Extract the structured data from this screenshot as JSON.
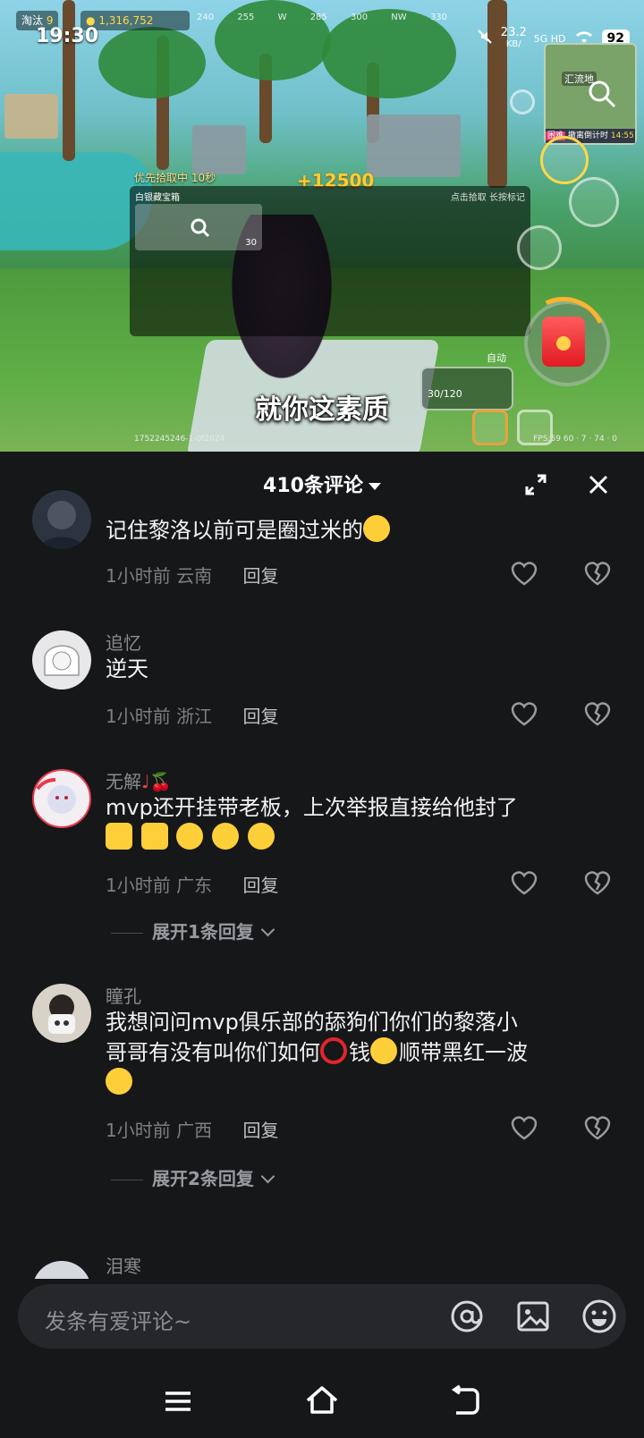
{
  "status_bar": {
    "time": "19:30",
    "network_speed": "23.2",
    "network_unit": "KB/",
    "network_type": "5G HD",
    "battery": "92"
  },
  "game": {
    "player_name": "淘汰",
    "player_count": "9",
    "coins": "1,316,752",
    "compass": [
      "240",
      "255",
      "W",
      "285",
      "300",
      "NW",
      "330"
    ],
    "minimap_label": "汇流地",
    "minimap_bottom_tag": "困难",
    "minimap_bottom_text": "撤离倒计时",
    "minimap_timer": "14:55",
    "pickup_text": "优先拾取中 10秒",
    "score_popup": "+12500",
    "loot_title": "白银藏宝箱",
    "loot_hint": "点击拾取 长按标记",
    "loot_count": "30",
    "subtitle": "就你这素质",
    "auto_label": "自动",
    "ammo_label": "30/120",
    "debug_id": "1752245246-1-0f2024",
    "fps_text": "FPS:59  60 · 7 · 74 · 0"
  },
  "sheet": {
    "title": "410条评论"
  },
  "comments": [
    {
      "name": "",
      "text": "记住黎洛以前可是圈过米的",
      "emojis": [
        "cry-laugh"
      ],
      "time": "1小时前",
      "location": "云南",
      "reply_label": "回复"
    },
    {
      "name": "追忆",
      "text": "逆天",
      "emojis": [],
      "time": "1小时前",
      "location": "浙江",
      "reply_label": "回复"
    },
    {
      "name": "无解",
      "name_decor": "♩🍒",
      "text": "mvp还开挂带老板，上次举报直接给他封了",
      "emojis": [
        "thumbs-up",
        "thumbs-up",
        "cry-laugh",
        "cry-laugh",
        "laugh"
      ],
      "time": "1小时前",
      "location": "广东",
      "reply_label": "回复",
      "expand_label": "展开1条回复"
    },
    {
      "name": "瞳孔",
      "text_line1": "我想问问mvp俱乐部的舔狗们你们的黎落小",
      "text_line2_a": "哥哥有没有叫你们如何",
      "text_line2_b": "钱",
      "text_line2_c": "顺带黑红一波",
      "emojis": [
        "red-circle",
        "cry-laugh",
        "cat-laugh"
      ],
      "time": "1小时前",
      "location": "广西",
      "reply_label": "回复",
      "expand_label": "展开2条回复"
    },
    {
      "name": "泪寒"
    }
  ],
  "input": {
    "placeholder": "发条有爱评论~"
  },
  "colors": {
    "sheet_bg": "#161719",
    "accent_gold": "#ffcc33",
    "emoji_yellow": "#ffcf3a"
  }
}
